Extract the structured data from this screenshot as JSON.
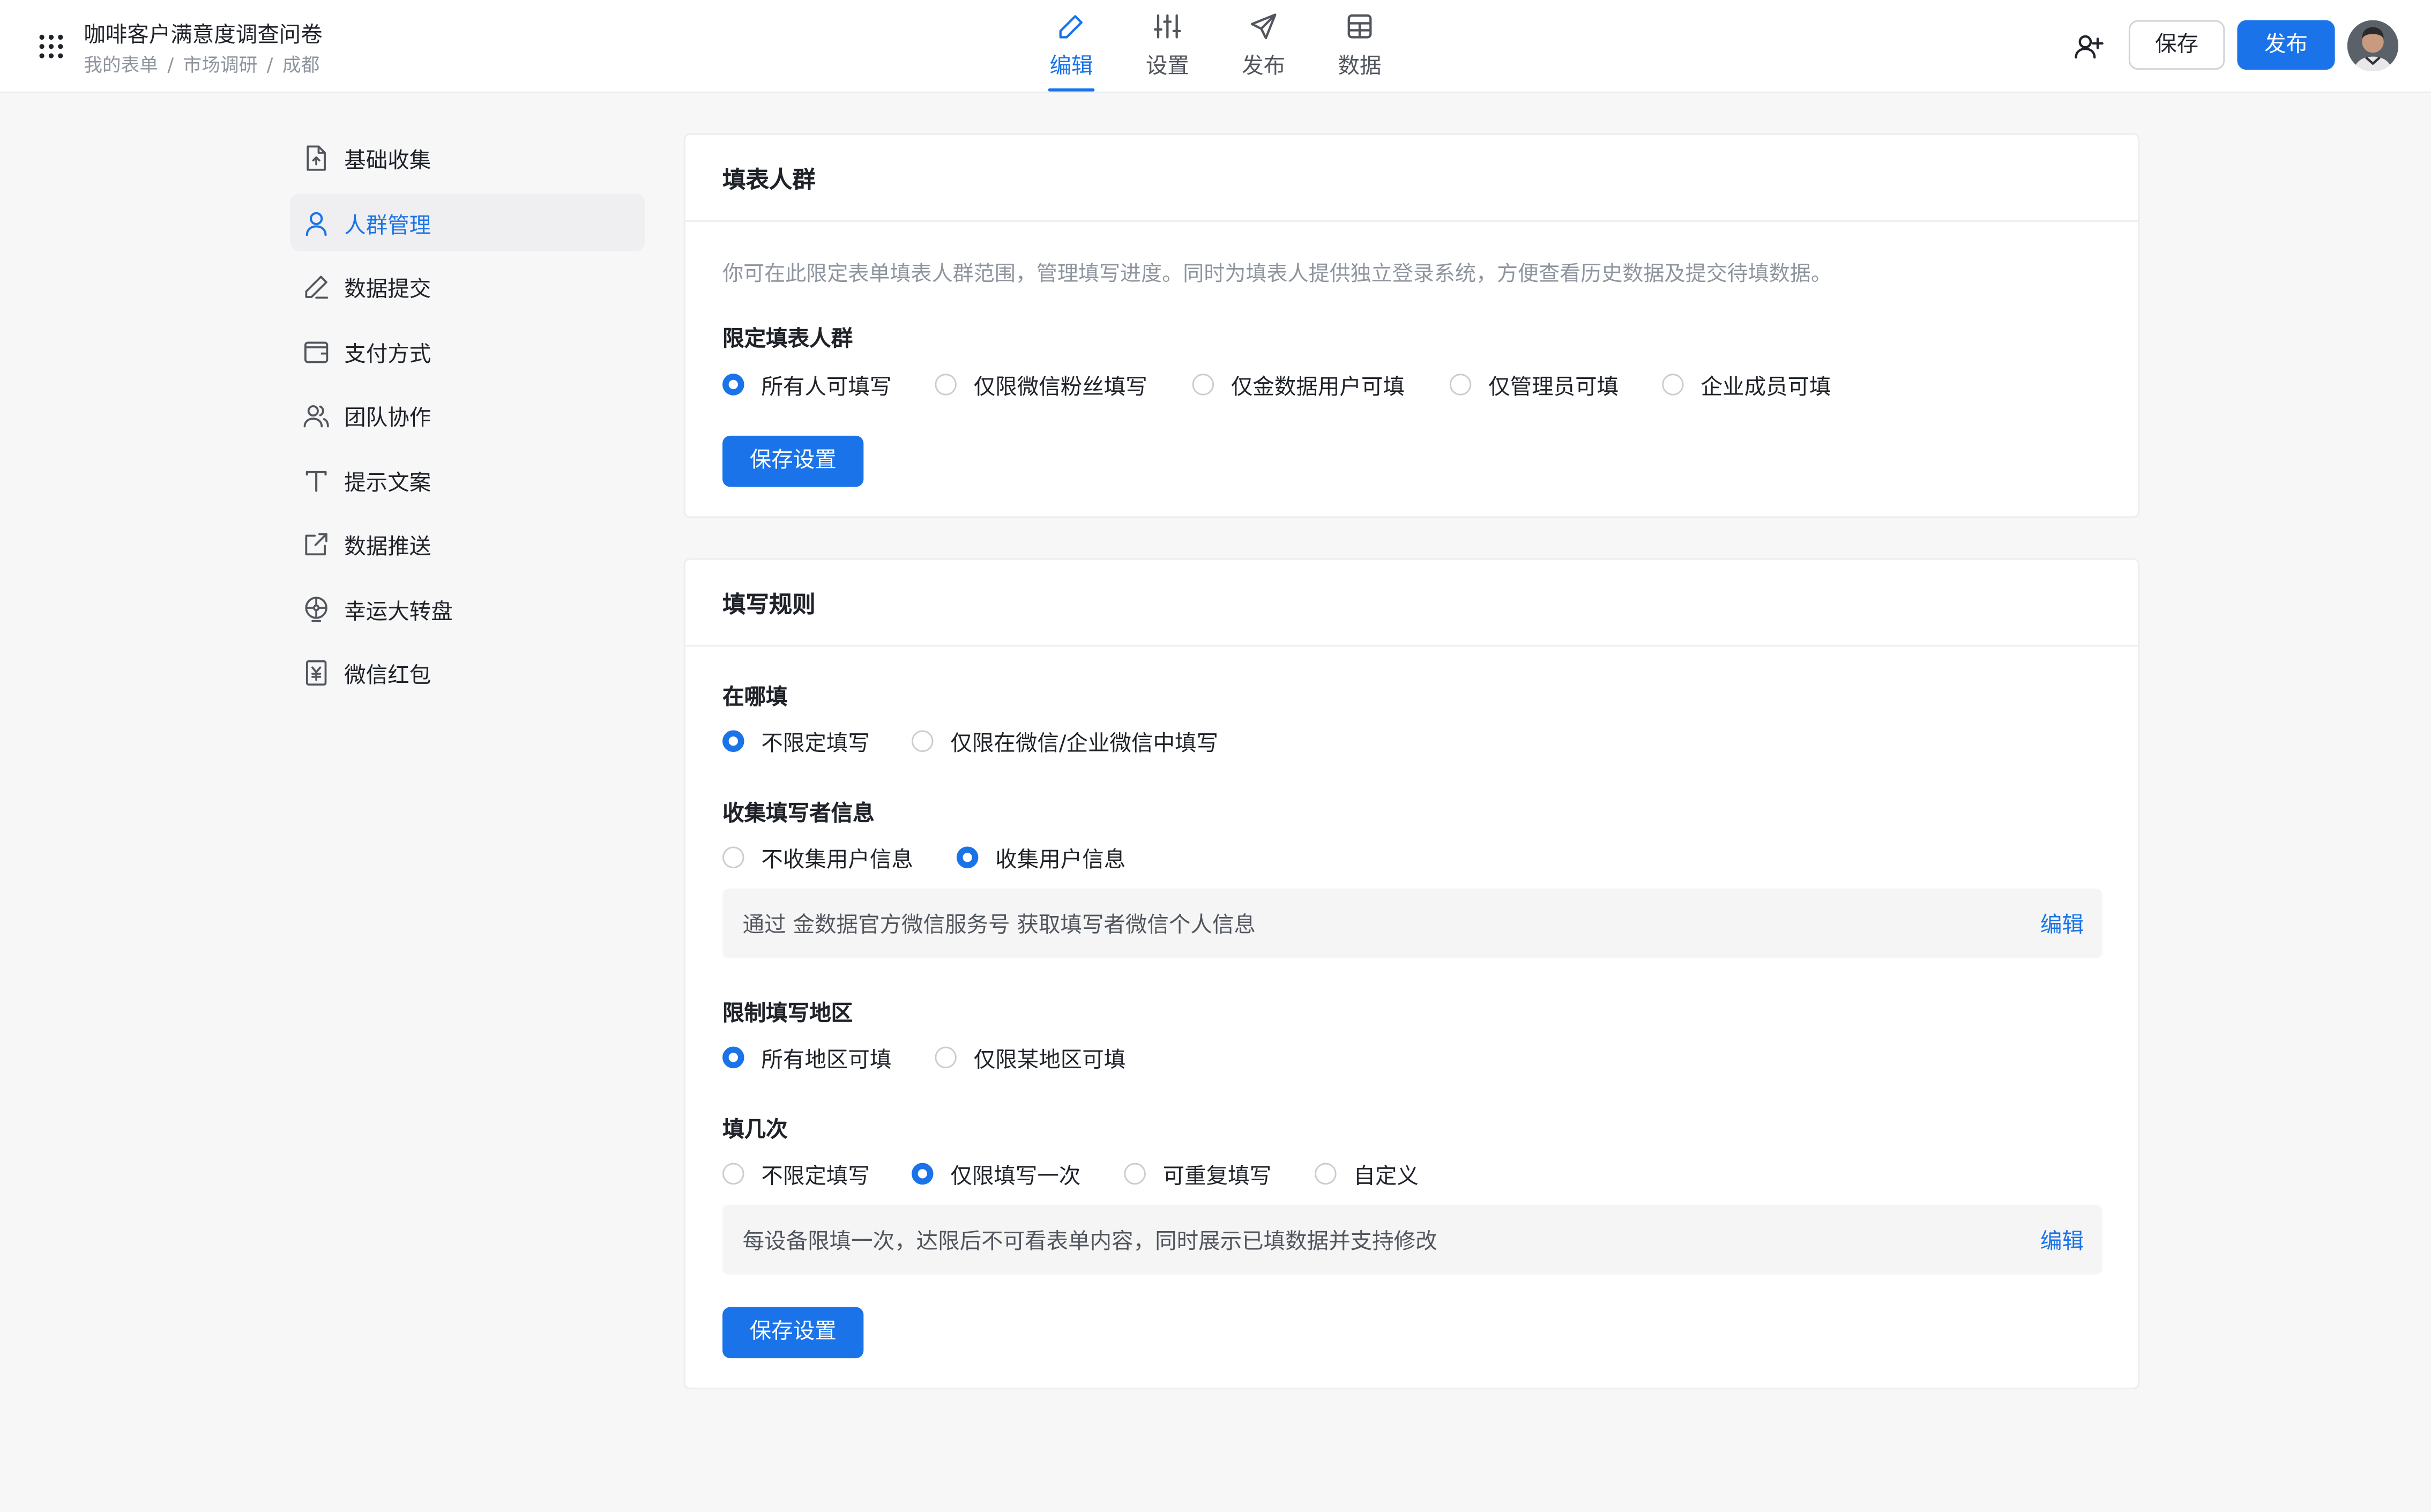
{
  "header": {
    "title": "咖啡客户满意度调查问卷",
    "breadcrumb": [
      "我的表单",
      "市场调研",
      "成都"
    ],
    "tabs": [
      {
        "label": "编辑",
        "icon": "pen-icon",
        "active": true
      },
      {
        "label": "设置",
        "icon": "sliders-icon",
        "active": false
      },
      {
        "label": "发布",
        "icon": "send-icon",
        "active": false
      },
      {
        "label": "数据",
        "icon": "table-icon",
        "active": false
      }
    ],
    "save_label": "保存",
    "publish_label": "发布"
  },
  "sidebar": {
    "items": [
      {
        "label": "基础收集",
        "icon": "file-upload-icon",
        "active": false
      },
      {
        "label": "人群管理",
        "icon": "user-icon",
        "active": true
      },
      {
        "label": "数据提交",
        "icon": "pencil-icon",
        "active": false
      },
      {
        "label": "支付方式",
        "icon": "wallet-icon",
        "active": false
      },
      {
        "label": "团队协作",
        "icon": "users-icon",
        "active": false
      },
      {
        "label": "提示文案",
        "icon": "text-icon",
        "active": false
      },
      {
        "label": "数据推送",
        "icon": "external-link-icon",
        "active": false
      },
      {
        "label": "幸运大转盘",
        "icon": "wheel-icon",
        "active": false
      },
      {
        "label": "微信红包",
        "icon": "red-packet-icon",
        "active": false
      }
    ]
  },
  "audience_card": {
    "title": "填表人群",
    "description": "你可在此限定表单填表人群范围，管理填写进度。同时为填表人提供独立登录系统，方便查看历史数据及提交待填数据。",
    "field_label": "限定填表人群",
    "options": [
      "所有人可填写",
      "仅限微信粉丝填写",
      "仅金数据用户可填",
      "仅管理员可填",
      "企业成员可填"
    ],
    "selected": 0,
    "save_button": "保存设置"
  },
  "rules_card": {
    "title": "填写规则",
    "where": {
      "label": "在哪填",
      "options": [
        "不限定填写",
        "仅限在微信/企业微信中填写"
      ],
      "selected": 0
    },
    "collect": {
      "label": "收集填写者信息",
      "options": [
        "不收集用户信息",
        "收集用户信息"
      ],
      "selected": 1,
      "info": "通过 金数据官方微信服务号 获取填写者微信个人信息",
      "edit": "编辑"
    },
    "region": {
      "label": "限制填写地区",
      "options": [
        "所有地区可填",
        "仅限某地区可填"
      ],
      "selected": 0
    },
    "times": {
      "label": "填几次",
      "options": [
        "不限定填写",
        "仅限填写一次",
        "可重复填写",
        "自定义"
      ],
      "selected": 1,
      "info": "每设备限填一次，达限后不可看表单内容，同时展示已填数据并支持修改",
      "edit": "编辑"
    },
    "save_button": "保存设置"
  },
  "colors": {
    "accent": "#1a73e8",
    "background": "#f7f7f8",
    "text": "#1f2329",
    "muted": "#8f959e"
  }
}
